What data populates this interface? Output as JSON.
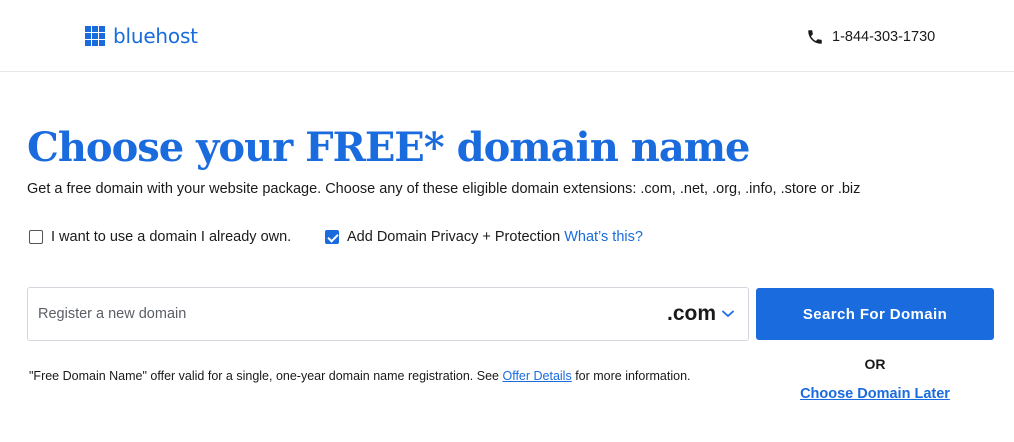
{
  "header": {
    "logo_text": "bluehost",
    "phone": "1-844-303-1730"
  },
  "main": {
    "title": "Choose your FREE* domain name",
    "subtitle": "Get a free domain with your website package. Choose any of these eligible domain extensions: .com, .net, .org, .info, .store or .biz",
    "options": {
      "own_domain": {
        "label": "I want to use a domain I already own.",
        "checked": false
      },
      "privacy": {
        "label": "Add Domain Privacy + Protection",
        "checked": true,
        "link": "What’s this?"
      }
    },
    "search": {
      "placeholder": "Register a new domain",
      "value": "",
      "tld_selected": ".com",
      "button_label": "Search For Domain"
    },
    "or_label": "OR",
    "choose_later_label": "Choose Domain Later",
    "disclaimer": {
      "prefix": "\"Free Domain Name\" offer valid for a single, one-year domain name registration. See ",
      "link": "Offer Details",
      "suffix": " for more information."
    }
  },
  "colors": {
    "brand_blue": "#196bde",
    "text": "#1a1a1a",
    "border": "#d4d7dd"
  },
  "icons": {
    "logo": "grid-logo-icon",
    "phone": "phone-icon",
    "tld_dropdown": "chevron-down-icon",
    "checkbox_checked": "checkmark-icon"
  }
}
